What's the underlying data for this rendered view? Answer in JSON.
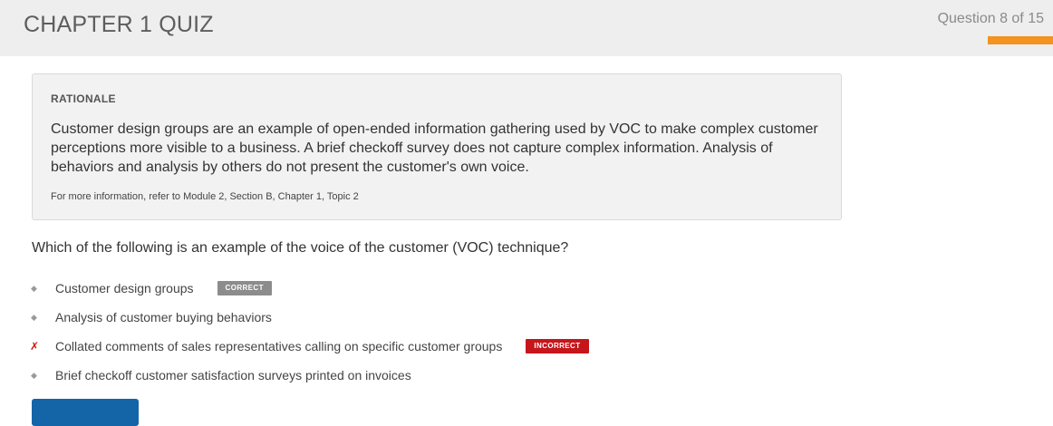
{
  "header": {
    "title": "CHAPTER 1 QUIZ",
    "progress_label": "Question 8 of 15",
    "accent_color": "#f39320"
  },
  "rationale": {
    "heading": "RATIONALE",
    "body": "Customer design groups are an example of open-ended information gathering used by VOC to make complex customer perceptions more visible to a business. A brief checkoff survey does not capture complex information. Analysis of behaviors and analysis by others do not present the customer's own voice.",
    "reference": "For more information, refer to Module 2, Section B, Chapter 1, Topic 2"
  },
  "question": {
    "text": "Which of the following is an example of the voice of the customer (VOC) technique?"
  },
  "answers": [
    {
      "marker": "◆",
      "text": "Customer design groups",
      "badge": "CORRECT",
      "status": "correct"
    },
    {
      "marker": "◆",
      "text": "Analysis of customer buying behaviors",
      "badge": "",
      "status": "none"
    },
    {
      "marker": "✗",
      "text": "Collated comments of sales representatives calling on specific customer groups",
      "badge": "INCORRECT",
      "status": "incorrect"
    },
    {
      "marker": "◆",
      "text": "Brief checkoff customer satisfaction surveys printed on invoices",
      "badge": "",
      "status": "none"
    }
  ],
  "colors": {
    "correct_badge": "#8c8c8c",
    "incorrect_badge": "#c6161c",
    "primary_button": "#1464a8"
  }
}
